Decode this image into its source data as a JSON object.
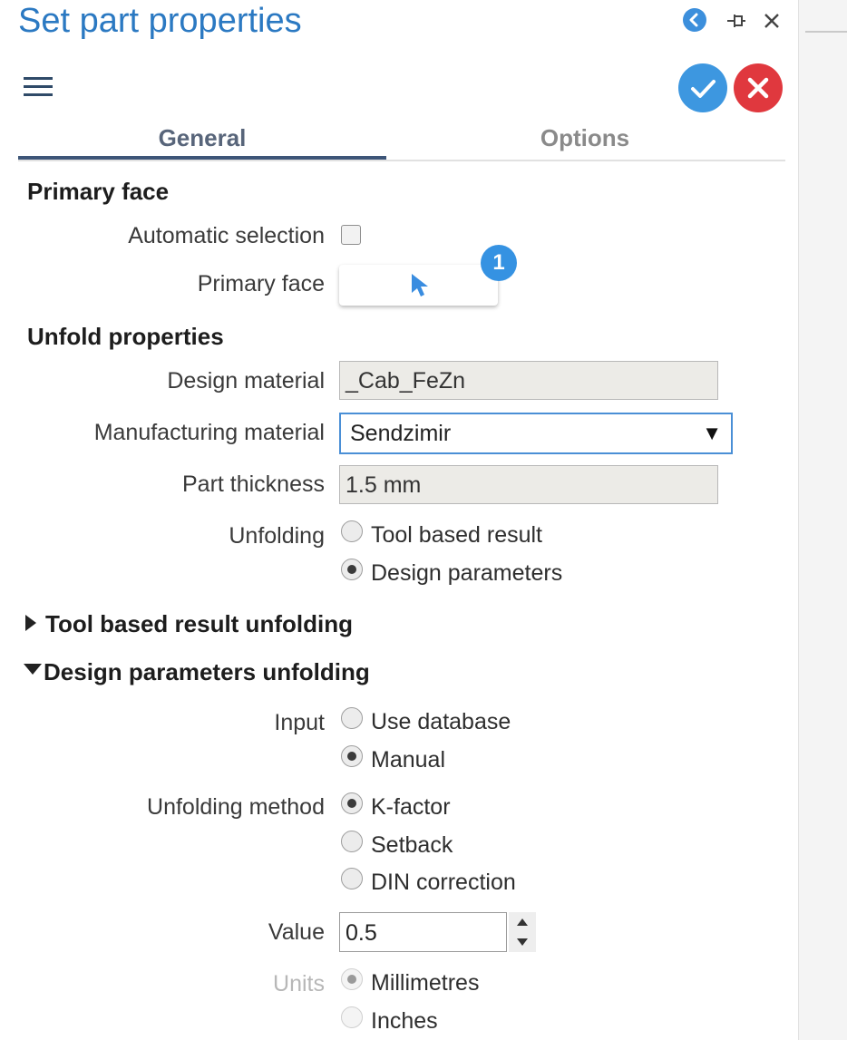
{
  "header": {
    "title": "Set part properties",
    "icons": [
      "back-icon",
      "pin-icon",
      "close-icon"
    ]
  },
  "toolbar": {
    "menu_icon": "hamburger-icon",
    "ok_icon": "check-icon",
    "cancel_icon": "x-icon"
  },
  "tabs": [
    {
      "label": "General",
      "active": true
    },
    {
      "label": "Options",
      "active": false
    }
  ],
  "primary_face": {
    "heading": "Primary face",
    "auto_label": "Automatic selection",
    "auto_checked": false,
    "face_label": "Primary face",
    "badge": "1"
  },
  "unfold": {
    "heading": "Unfold properties",
    "design_material_label": "Design material",
    "design_material_value": "_Cab_FeZn",
    "mfg_material_label": "Manufacturing material",
    "mfg_material_value": "Sendzimir",
    "thickness_label": "Part thickness",
    "thickness_value": "1.5 mm",
    "unfolding_label": "Unfolding",
    "unfolding_options": [
      "Tool based result",
      "Design parameters"
    ],
    "unfolding_selected": "Design parameters"
  },
  "tool_section": {
    "heading": "Tool based result unfolding",
    "expanded": false
  },
  "design_section": {
    "heading": "Design parameters unfolding",
    "expanded": true,
    "input_label": "Input",
    "input_options": [
      "Use database",
      "Manual"
    ],
    "input_selected": "Manual",
    "method_label": "Unfolding method",
    "method_options": [
      "K-factor",
      "Setback",
      "DIN correction"
    ],
    "method_selected": "K-factor",
    "value_label": "Value",
    "value": "0.5",
    "units_label": "Units",
    "units_options": [
      "Millimetres",
      "Inches"
    ],
    "units_selected": "Millimetres"
  },
  "colors": {
    "title": "#2b79c2",
    "ok": "#3d97e0",
    "cancel": "#e0383e",
    "badge": "#3592e2",
    "select_border": "#4a8fd6"
  }
}
